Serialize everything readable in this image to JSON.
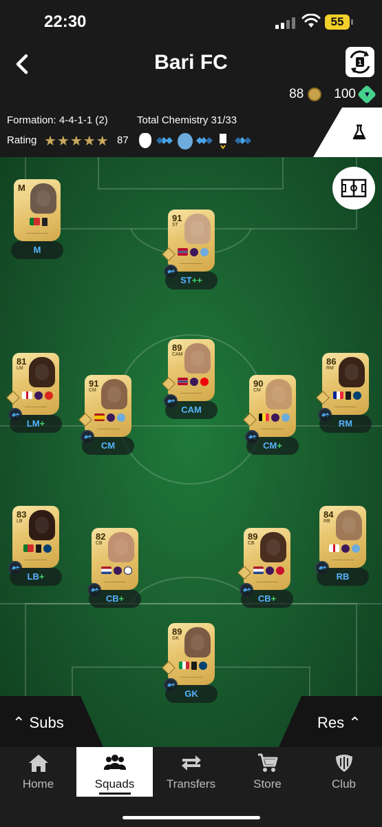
{
  "status_bar": {
    "time": "22:30",
    "battery": "55"
  },
  "header": {
    "title": "Bari FC",
    "coins": "88",
    "points": "100"
  },
  "info": {
    "formation": "Formation: 4-4-1-1 (2)",
    "total_chemistry": "Total Chemistry 31/33",
    "rating_label": "Rating",
    "stars": "★★★★★",
    "rating": "87"
  },
  "players": [
    {
      "rating": "M",
      "position": "",
      "label": "M",
      "plus": ""
    },
    {
      "rating": "91",
      "position": "ST",
      "label": "ST",
      "plus": "++"
    },
    {
      "rating": "81",
      "position": "LM",
      "label": "LM",
      "plus": "+"
    },
    {
      "rating": "91",
      "position": "CM",
      "label": "CM",
      "plus": ""
    },
    {
      "rating": "89",
      "position": "CAM",
      "label": "CAM",
      "plus": ""
    },
    {
      "rating": "90",
      "position": "CM",
      "label": "CM",
      "plus": "+"
    },
    {
      "rating": "86",
      "position": "RM",
      "label": "RM",
      "plus": ""
    },
    {
      "rating": "83",
      "position": "LB",
      "label": "LB",
      "plus": "+"
    },
    {
      "rating": "82",
      "position": "CB",
      "label": "CB",
      "plus": "+"
    },
    {
      "rating": "89",
      "position": "CB",
      "label": "CB",
      "plus": "+"
    },
    {
      "rating": "84",
      "position": "RB",
      "label": "RB",
      "plus": ""
    },
    {
      "rating": "89",
      "position": "GK",
      "label": "GK",
      "plus": ""
    }
  ],
  "bench": {
    "subs": "Subs",
    "res": "Res"
  },
  "nav": [
    {
      "label": "Home"
    },
    {
      "label": "Squads"
    },
    {
      "label": "Transfers"
    },
    {
      "label": "Store"
    },
    {
      "label": "Club"
    }
  ],
  "colors": {
    "pitch": "#1a5e2f",
    "gold_card": "#e7c46d",
    "chem_blue": "#56b4ff",
    "plus_green": "#45d26b"
  }
}
